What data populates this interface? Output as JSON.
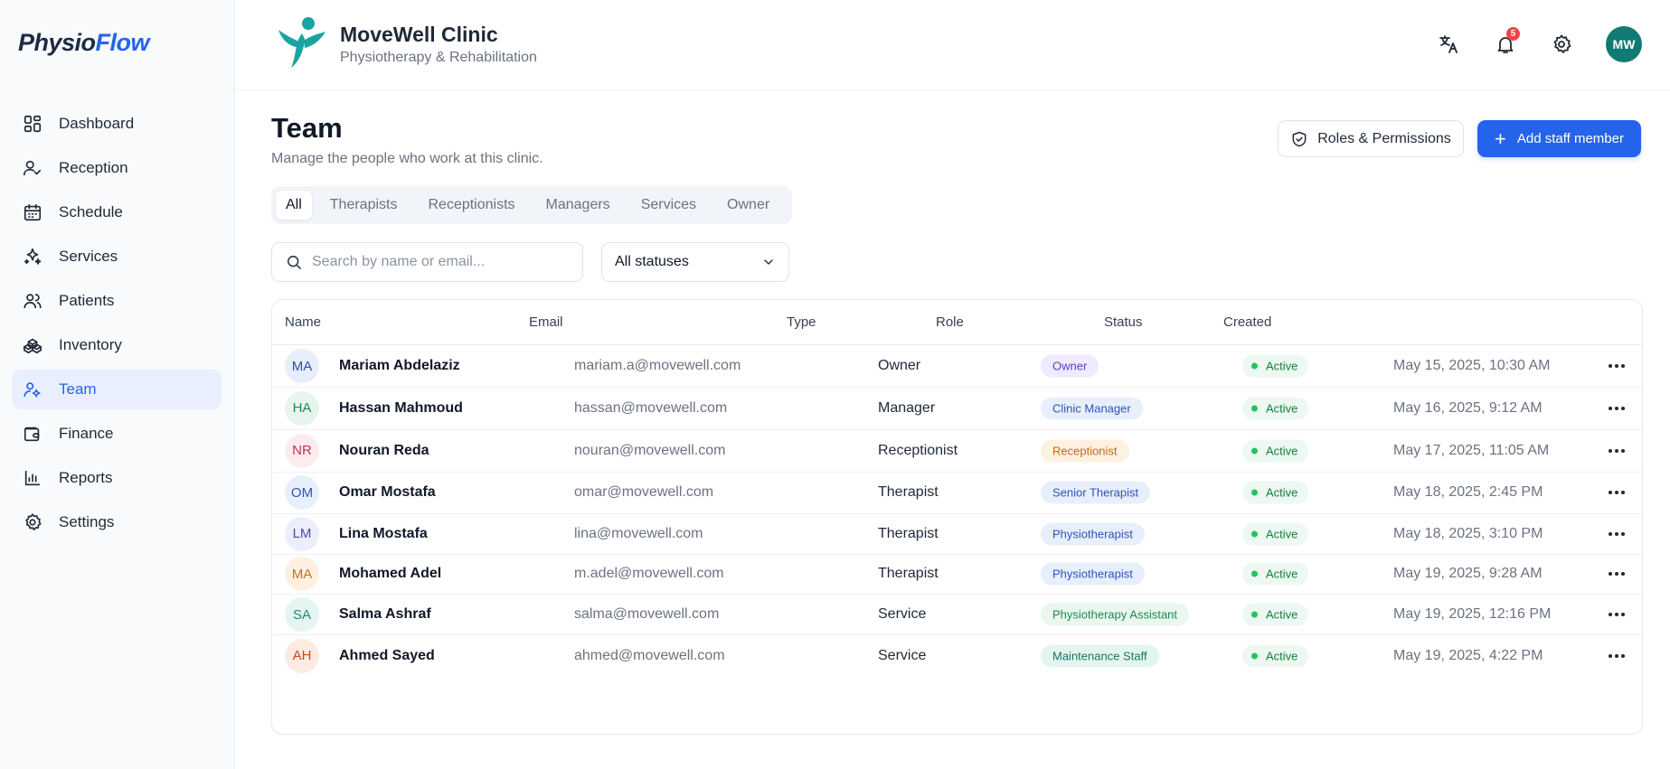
{
  "app": {
    "brand_part1": "Physio",
    "brand_part2": "Flow"
  },
  "sidebar": {
    "items": [
      {
        "label": "Dashboard",
        "icon": "dashboard-icon"
      },
      {
        "label": "Reception",
        "icon": "user-check-icon"
      },
      {
        "label": "Schedule",
        "icon": "calendar-icon"
      },
      {
        "label": "Services",
        "icon": "sparkles-icon"
      },
      {
        "label": "Patients",
        "icon": "users-icon"
      },
      {
        "label": "Inventory",
        "icon": "boxes-icon"
      },
      {
        "label": "Team",
        "icon": "team-icon",
        "active": true
      },
      {
        "label": "Finance",
        "icon": "wallet-icon"
      },
      {
        "label": "Reports",
        "icon": "bar-chart-icon"
      },
      {
        "label": "Settings",
        "icon": "gear-icon"
      }
    ]
  },
  "header": {
    "clinic_name": "MoveWell Clinic",
    "clinic_subtitle": "Physiotherapy & Rehabilitation",
    "notification_count": "5",
    "avatar_initials": "MW"
  },
  "page": {
    "title": "Team",
    "subtitle": "Manage the people who work at this clinic.",
    "roles_button": "Roles & Permissions",
    "add_button": "Add staff member"
  },
  "tabs": [
    "All",
    "Therapists",
    "Receptionists",
    "Managers",
    "Services",
    "Owner"
  ],
  "filters": {
    "search_placeholder": "Search by name or email...",
    "status_selected": "All statuses"
  },
  "table": {
    "columns": [
      "Name",
      "Email",
      "Type",
      "Role",
      "Status",
      "Created"
    ],
    "rows": [
      {
        "initials": "MA",
        "name": "Mariam Abdelaziz",
        "email": "mariam.a@movewell.com",
        "type": "Owner",
        "role": "Owner",
        "status": "Active",
        "created": "May 15, 2025, 10:30 AM",
        "avatar_bg": "#e8edfb",
        "avatar_fg": "#2f4fa8",
        "role_bg": "#efeafd",
        "role_fg": "#5b3fc4"
      },
      {
        "initials": "HA",
        "name": "Hassan Mahmoud",
        "email": "hassan@movewell.com",
        "type": "Manager",
        "role": "Clinic Manager",
        "status": "Active",
        "created": "May 16, 2025, 9:12 AM",
        "avatar_bg": "#e7f5ee",
        "avatar_fg": "#1f8a5a",
        "role_bg": "#e8effc",
        "role_fg": "#2d55b8"
      },
      {
        "initials": "NR",
        "name": "Nouran Reda",
        "email": "nouran@movewell.com",
        "type": "Receptionist",
        "role": "Receptionist",
        "status": "Active",
        "created": "May 17, 2025, 11:05 AM",
        "avatar_bg": "#fdecef",
        "avatar_fg": "#c0344f",
        "role_bg": "#fdf1e2",
        "role_fg": "#c56a12"
      },
      {
        "initials": "OM",
        "name": "Omar Mostafa",
        "email": "omar@movewell.com",
        "type": "Therapist",
        "role": "Senior Therapist",
        "status": "Active",
        "created": "May 18, 2025, 2:45 PM",
        "avatar_bg": "#e8effc",
        "avatar_fg": "#2d55b8",
        "role_bg": "#e8effc",
        "role_fg": "#2d55b8"
      },
      {
        "initials": "LM",
        "name": "Lina Mostafa",
        "email": "lina@movewell.com",
        "type": "Therapist",
        "role": "Physiotherapist",
        "status": "Active",
        "created": "May 18, 2025, 3:10 PM",
        "avatar_bg": "#eceefb",
        "avatar_fg": "#4b4f9e",
        "role_bg": "#e8effc",
        "role_fg": "#2d55b8"
      },
      {
        "initials": "MA",
        "name": "Mohamed Adel",
        "email": "m.adel@movewell.com",
        "type": "Therapist",
        "role": "Physiotherapist",
        "status": "Active",
        "created": "May 19, 2025, 9:28 AM",
        "avatar_bg": "#fdf0e1",
        "avatar_fg": "#c2741c",
        "role_bg": "#e8effc",
        "role_fg": "#2d55b8"
      },
      {
        "initials": "SA",
        "name": "Salma Ashraf",
        "email": "salma@movewell.com",
        "type": "Service",
        "role": "Physiotherapy Assistant",
        "status": "Active",
        "created": "May 19, 2025, 12:16 PM",
        "avatar_bg": "#e5f5f1",
        "avatar_fg": "#1b8a78",
        "role_bg": "#e9f7ef",
        "role_fg": "#1f8a4e"
      },
      {
        "initials": "AH",
        "name": "Ahmed Sayed",
        "email": "ahmed@movewell.com",
        "type": "Service",
        "role": "Maintenance Staff",
        "status": "Active",
        "created": "May 19, 2025, 4:22 PM",
        "avatar_bg": "#fdebe2",
        "avatar_fg": "#c4471c",
        "role_bg": "#e4f5f1",
        "role_fg": "#17775f"
      }
    ]
  },
  "colors": {
    "accent": "#2563eb",
    "sidebar_active_bg": "#e9efff",
    "status_active": "#22c55e",
    "clinic_logo": "#1aa3a0"
  }
}
